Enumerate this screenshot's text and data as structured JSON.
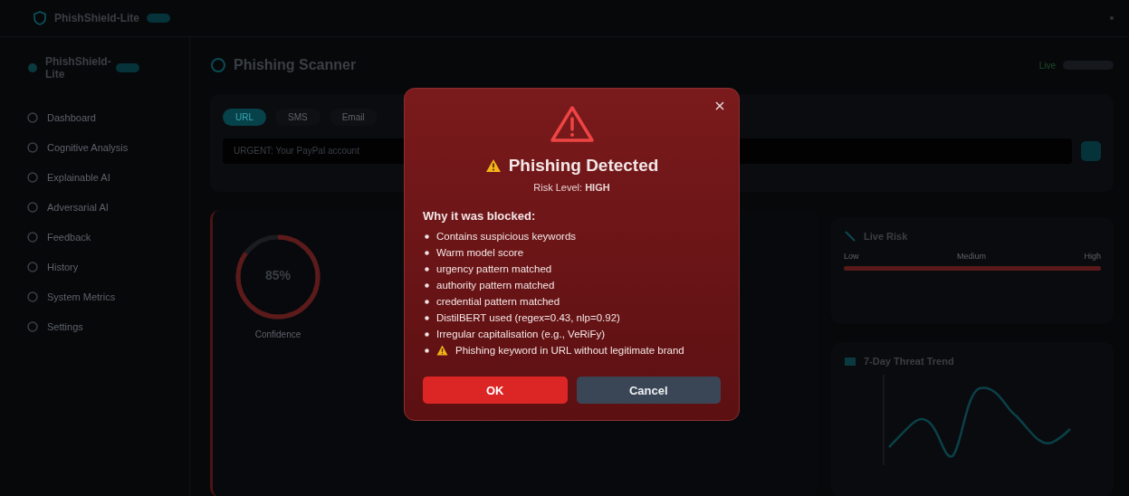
{
  "topbar": {
    "brand": "PhishShield-Lite"
  },
  "sidebar": {
    "brand": "PhishShield-Lite",
    "items": [
      {
        "label": "Dashboard",
        "selected": false
      },
      {
        "label": "Cognitive Analysis",
        "selected": false
      },
      {
        "label": "Explainable AI",
        "selected": false
      },
      {
        "label": "Adversarial AI",
        "selected": false
      },
      {
        "label": "Feedback",
        "selected": false
      },
      {
        "label": "History",
        "selected": false
      },
      {
        "label": "System Metrics",
        "selected": false
      },
      {
        "label": "Settings",
        "selected": false
      }
    ]
  },
  "page": {
    "title": "Phishing Scanner",
    "status": "Live"
  },
  "scanner": {
    "tabs": [
      {
        "label": "URL",
        "selected": true
      },
      {
        "label": "SMS",
        "selected": false
      },
      {
        "label": "Email",
        "selected": false
      }
    ],
    "input_value": "URGENT: Your PayPal account"
  },
  "result": {
    "gauge_value": "85%",
    "level": 0.85,
    "gauge_label": "Confidence"
  },
  "live_risk": {
    "title": "Live Risk",
    "scale": [
      "Low",
      "Medium",
      "High"
    ],
    "level": 1.0
  },
  "trend": {
    "title": "7-Day Threat Trend"
  },
  "modal": {
    "title": "Phishing Detected",
    "risk": "Risk Level: **HIGH**",
    "reasons_heading": "Why it was blocked:",
    "reasons": [
      {
        "text": "Contains suspicious keywords",
        "warning": false
      },
      {
        "text": "Warm model score",
        "warning": false
      },
      {
        "text": "urgency pattern matched",
        "warning": false
      },
      {
        "text": "authority pattern matched",
        "warning": false
      },
      {
        "text": "credential pattern matched",
        "warning": false
      },
      {
        "text": "DistilBERT used (regex=0.43, nlp=0.92)",
        "warning": false
      },
      {
        "text": "Irregular capitalisation (e.g., VeRiFy)",
        "warning": false
      },
      {
        "text": "Phishing keyword in URL without legitimate brand",
        "warning": true
      }
    ],
    "buttons": [
      {
        "label": "OK",
        "kind": "primary"
      },
      {
        "label": "Cancel",
        "kind": "secondary"
      }
    ]
  }
}
